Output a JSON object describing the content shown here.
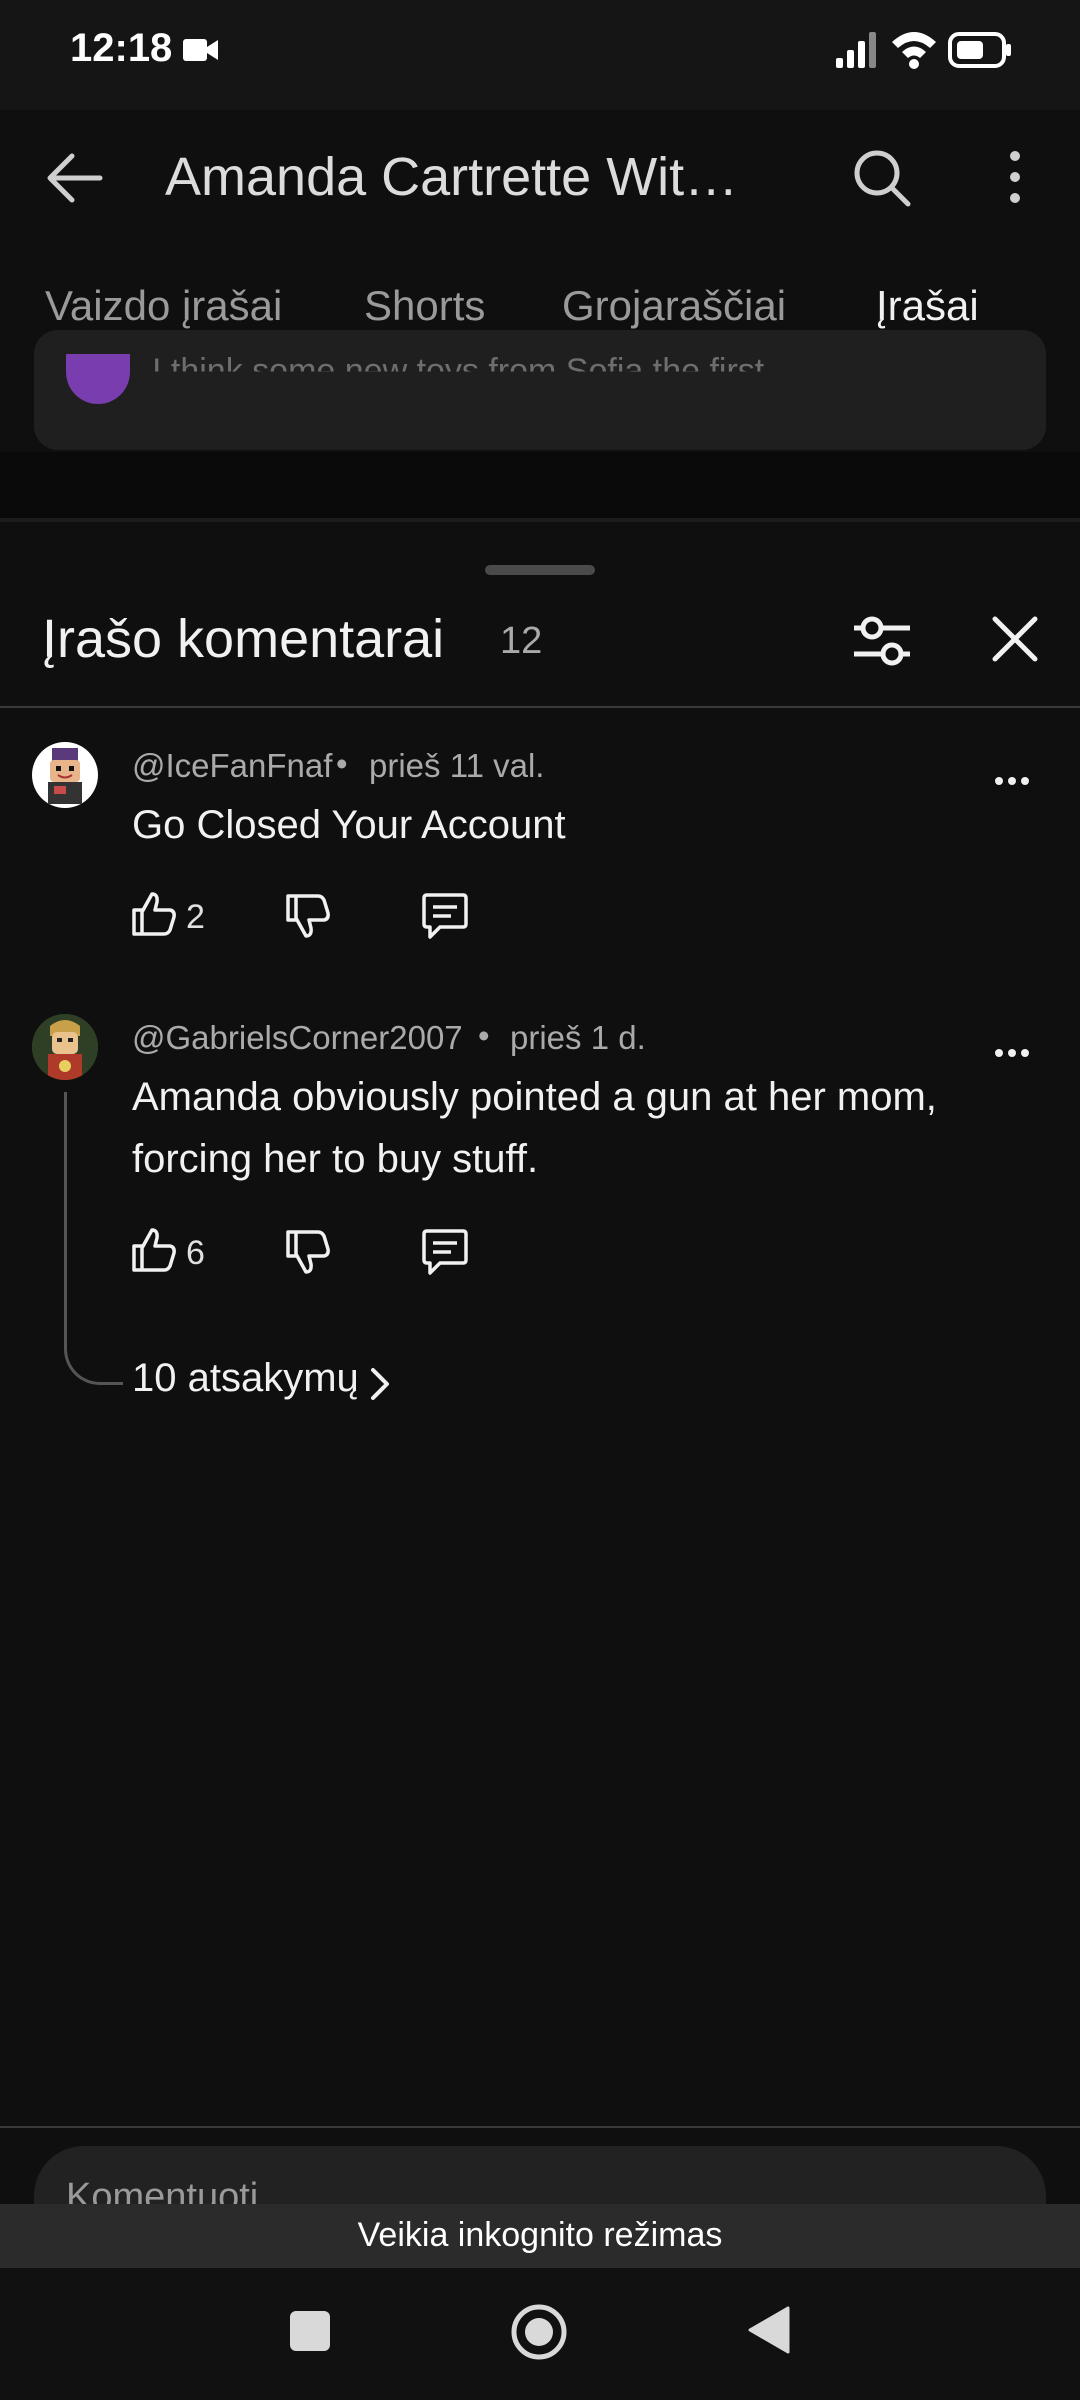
{
  "status_bar": {
    "time": "12:18"
  },
  "header": {
    "title": "Amanda Cartrette Wit…",
    "tabs": [
      {
        "label": "Vaizdo įrašai"
      },
      {
        "label": "Shorts"
      },
      {
        "label": "Grojaraščiai"
      },
      {
        "label": "Įrašai",
        "active": true
      }
    ]
  },
  "background_post": {
    "text": "I think some new toys from Sofia the first"
  },
  "sheet": {
    "title": "Įrašo komentarai",
    "count": "12"
  },
  "comments": [
    {
      "author": "@IceFanFnaf",
      "separator": "•",
      "time": "prieš 11 val.",
      "text": "Go Closed Your Account",
      "likes": "2"
    },
    {
      "author": "@GabrielsCorner2007",
      "separator": "•",
      "time": "prieš 1 d.",
      "text_line1": "Amanda obviously pointed a gun at her mom,",
      "text_line2": "forcing her to buy stuff.",
      "likes": "6",
      "replies": "10 atsakymų"
    }
  ],
  "composer": {
    "placeholder": "Komentuoti"
  },
  "incognito": {
    "text": "Veikia inkognito režimas"
  },
  "colors": {
    "background": "#0f0f0f",
    "text": "#f1f1f1",
    "secondary_text": "#aaaaaa"
  }
}
